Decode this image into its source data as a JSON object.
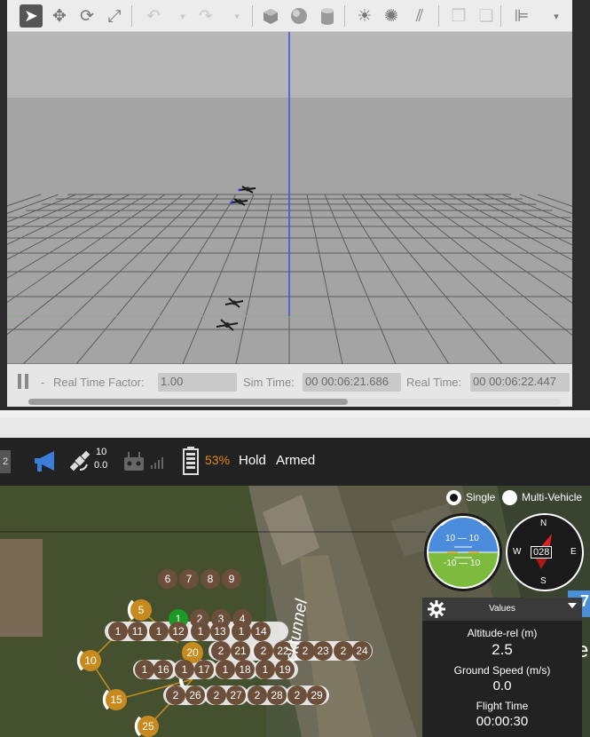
{
  "gazebo": {
    "toolbar_icons": [
      {
        "name": "select-arrow-icon",
        "glyph": "➤"
      },
      {
        "name": "translate-icon",
        "glyph": "✥"
      },
      {
        "name": "rotate-icon",
        "glyph": "⟳"
      },
      {
        "name": "scale-icon",
        "glyph": "⤢"
      },
      {
        "name": "undo-icon",
        "glyph": "↶"
      },
      {
        "name": "undo-dropdown-icon",
        "glyph": "▾"
      },
      {
        "name": "redo-icon",
        "glyph": "↷"
      },
      {
        "name": "redo-dropdown-icon",
        "glyph": "▾"
      },
      {
        "name": "box-shape-icon",
        "glyph": ""
      },
      {
        "name": "sphere-shape-icon",
        "glyph": ""
      },
      {
        "name": "cylinder-shape-icon",
        "glyph": ""
      },
      {
        "name": "point-light-icon",
        "glyph": "☀"
      },
      {
        "name": "spot-light-icon",
        "glyph": "✺"
      },
      {
        "name": "directional-light-icon",
        "glyph": "⫽"
      },
      {
        "name": "copy-icon",
        "glyph": "❐"
      },
      {
        "name": "paste-icon",
        "glyph": "❏"
      },
      {
        "name": "align-icon",
        "glyph": "⊫"
      },
      {
        "name": "more-dropdown-icon",
        "glyph": "▾"
      }
    ],
    "status": {
      "dash": "-",
      "real_time_factor_label": "Real Time Factor:",
      "real_time_factor": "1.00",
      "sim_time_label": "Sim Time:",
      "sim_time": "00 00:06:21.686",
      "real_time_label": "Real Time:",
      "real_time": "00 00:06:22.447"
    }
  },
  "qgc": {
    "left_tab": "2",
    "gps": {
      "satellites": "10",
      "hdop": "0.0"
    },
    "battery": "53%",
    "flight_mode": "Hold",
    "arm_state": "Armed",
    "vehicle_mode": {
      "single": "Single",
      "multi": "Multi-Vehicle"
    },
    "attitude": {
      "upper": "10 — 10",
      "lower": "-10 — 10"
    },
    "compass": {
      "heading": "028",
      "n": "N",
      "e": "E",
      "s": "S",
      "w": "W"
    },
    "values_panel": {
      "title": "Values",
      "items": [
        {
          "label": "Altitude-rel (m)",
          "value": "2.5"
        },
        {
          "label": "Ground Speed (m/s)",
          "value": "0.0"
        },
        {
          "label": "Flight Time",
          "value": "00:00:30"
        }
      ]
    },
    "map_street_label": "cktunnel",
    "edge_badge": "7",
    "edge_letter": "e",
    "waypoints": [
      {
        "label": "5",
        "kind": "orange"
      },
      {
        "label": "6",
        "kind": "brown"
      },
      {
        "label": "7",
        "kind": "brown"
      },
      {
        "label": "8",
        "kind": "brown"
      },
      {
        "label": "9",
        "kind": "brown"
      },
      {
        "label": "1",
        "kind": "green"
      },
      {
        "label": "2",
        "kind": "brown"
      },
      {
        "label": "3",
        "kind": "brown"
      },
      {
        "label": "4",
        "kind": "brown"
      },
      {
        "label": "10",
        "kind": "orange"
      },
      {
        "label": "1",
        "kind": "brown"
      },
      {
        "label": "11",
        "kind": "brown"
      },
      {
        "label": "1",
        "kind": "brown"
      },
      {
        "label": "12",
        "kind": "brown"
      },
      {
        "label": "1",
        "kind": "brown"
      },
      {
        "label": "13",
        "kind": "brown"
      },
      {
        "label": "1",
        "kind": "brown"
      },
      {
        "label": "14",
        "kind": "brown"
      },
      {
        "label": "2",
        "kind": "brown"
      },
      {
        "label": "21",
        "kind": "brown"
      },
      {
        "label": "2",
        "kind": "brown"
      },
      {
        "label": "22",
        "kind": "brown"
      },
      {
        "label": "2",
        "kind": "brown"
      },
      {
        "label": "23",
        "kind": "brown"
      },
      {
        "label": "2",
        "kind": "brown"
      },
      {
        "label": "24",
        "kind": "brown"
      },
      {
        "label": "20",
        "kind": "orange"
      },
      {
        "label": "15",
        "kind": "orange"
      },
      {
        "label": "1",
        "kind": "brown"
      },
      {
        "label": "16",
        "kind": "brown"
      },
      {
        "label": "1",
        "kind": "brown"
      },
      {
        "label": "17",
        "kind": "brown"
      },
      {
        "label": "1",
        "kind": "brown"
      },
      {
        "label": "18",
        "kind": "brown"
      },
      {
        "label": "1",
        "kind": "brown"
      },
      {
        "label": "19",
        "kind": "brown"
      },
      {
        "label": "25",
        "kind": "orange"
      },
      {
        "label": "2",
        "kind": "brown"
      },
      {
        "label": "26",
        "kind": "brown"
      },
      {
        "label": "2",
        "kind": "brown"
      },
      {
        "label": "27",
        "kind": "brown"
      },
      {
        "label": "2",
        "kind": "brown"
      },
      {
        "label": "28",
        "kind": "brown"
      },
      {
        "label": "2",
        "kind": "brown"
      },
      {
        "label": "29",
        "kind": "brown"
      }
    ],
    "colors": {
      "accent_orange": "#c68a1f",
      "battery_orange": "#e38b1a",
      "speaker_blue": "#3b7dd8",
      "mission_green": "#1c9b22"
    }
  }
}
